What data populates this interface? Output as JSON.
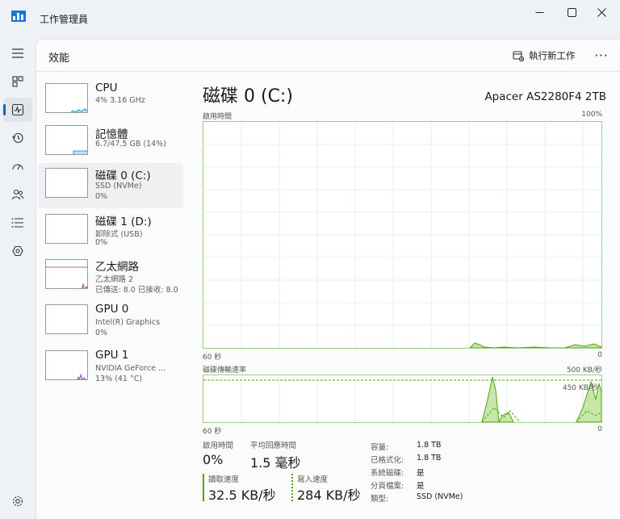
{
  "window": {
    "title": "工作管理員",
    "controls": {
      "minimize": "minimize-icon",
      "maximize": "maximize-icon",
      "close": "close-icon"
    }
  },
  "nav": {
    "items": [
      "hamburger-icon",
      "processes-icon",
      "performance-icon",
      "app-history-icon",
      "startup-icon",
      "users-icon",
      "details-icon",
      "services-icon",
      "settings-icon"
    ],
    "active": "performance-icon"
  },
  "header": {
    "title": "效能",
    "run_task_label": "執行新工作",
    "more_label": "···"
  },
  "sidebar": {
    "items": [
      {
        "name": "CPU",
        "line1": "4% 3.16 GHz",
        "line2": "",
        "line3": ""
      },
      {
        "name": "記憶體",
        "line1": "6.7/47.5 GB (14%)",
        "line2": "",
        "line3": ""
      },
      {
        "name": "磁碟 0 (C:)",
        "line1": "SSD (NVMe)",
        "line2": "0%",
        "line3": ""
      },
      {
        "name": "磁碟 1 (D:)",
        "line1": "卸除式 (USB)",
        "line2": "0%",
        "line3": ""
      },
      {
        "name": "乙太網路",
        "line1": "乙太網路 2",
        "line2": "已傳送: 8.0 已接收: 8.0",
        "line3": ""
      },
      {
        "name": "GPU 0",
        "line1": "Intel(R) Graphics",
        "line2": "0%",
        "line3": ""
      },
      {
        "name": "GPU 1",
        "line1": "NVIDIA GeForce ...",
        "line2": "13% (41 °C)",
        "line3": ""
      }
    ],
    "selected_index": 2
  },
  "main": {
    "title": "磁碟 0 (C:)",
    "model": "Apacer AS2280F4 2TB",
    "graph1": {
      "label_left": "啟用時間",
      "label_right": "100%",
      "bottom_left": "60 秒",
      "bottom_right": "0"
    },
    "graph2": {
      "label_left": "磁碟傳輸速率",
      "label_right": "500 KB/秒",
      "inner_label": "450 KB/秒",
      "bottom_left": "60 秒",
      "bottom_right": "0"
    },
    "stats": {
      "active_time_label": "啟用時間",
      "active_time_value": "0%",
      "avg_response_label": "平均回應時間",
      "avg_response_value": "1.5 毫秒",
      "read_label": "讀取速度",
      "read_value": "32.5 KB/秒",
      "write_label": "寫入速度",
      "write_value": "284 KB/秒"
    },
    "properties": [
      {
        "key": "容量:",
        "value": "1.8 TB"
      },
      {
        "key": "已格式化:",
        "value": "1.8 TB"
      },
      {
        "key": "系統磁碟:",
        "value": "是"
      },
      {
        "key": "分頁檔案:",
        "value": "是"
      },
      {
        "key": "類型:",
        "value": "SSD (NVMe)"
      }
    ]
  },
  "colors": {
    "accent": "#0067c0",
    "disk_green": "#4da60c",
    "disk_fill": "#c6e6aa",
    "network_red": "#a93a3a",
    "gpu_purple": "#8f3fd1",
    "cpu_blue": "#117dbb"
  }
}
